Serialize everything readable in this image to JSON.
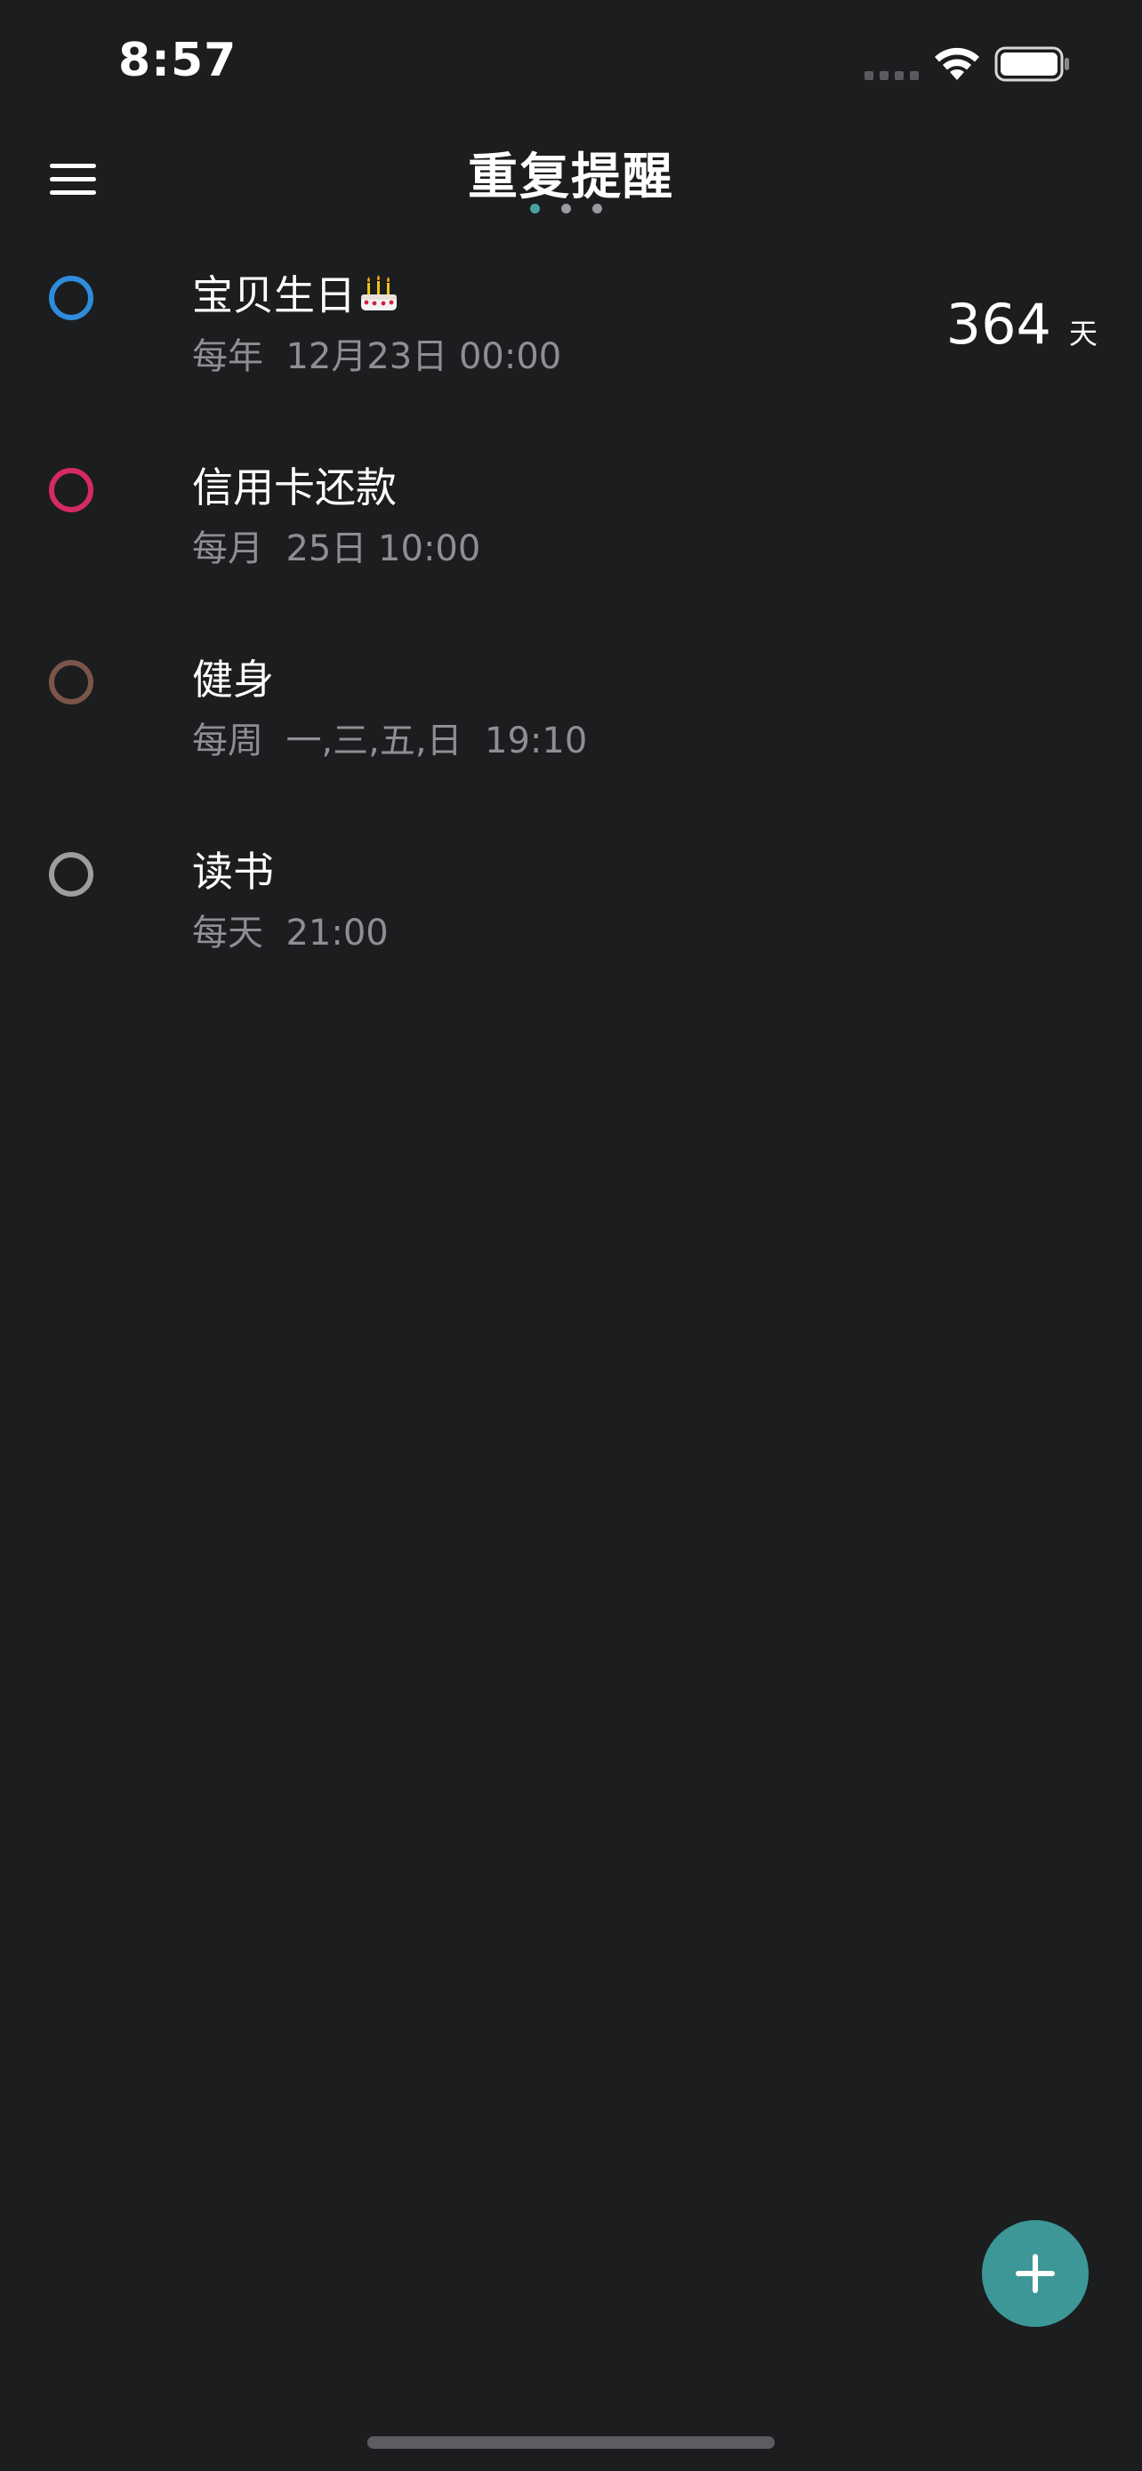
{
  "status_bar": {
    "time": "8:57",
    "wifi_icon": "wifi-icon",
    "battery_icon": "battery-icon"
  },
  "header": {
    "title": "重复提醒",
    "menu_icon": "hamburger-menu-icon",
    "page_indicator": {
      "total": 3,
      "active": 1
    }
  },
  "reminders": [
    {
      "title": "宝贝生日",
      "title_icon": "birthday-cake-icon",
      "frequency": "每年",
      "schedule": "12月23日 00:00",
      "circle_color": "#2e8cdc",
      "countdown": "364",
      "countdown_unit": "天"
    },
    {
      "title": "信用卡还款",
      "frequency": "每月",
      "schedule": "25日 10:00",
      "circle_color": "#d62a62"
    },
    {
      "title": "健身",
      "frequency": "每周",
      "schedule": "一,三,五,日  19:10",
      "circle_color": "#7b554a"
    },
    {
      "title": "读书",
      "frequency": "每天",
      "schedule": "21:00",
      "circle_color": "#9e9ea0"
    }
  ],
  "fab": {
    "icon": "plus-icon",
    "color": "#3d9797"
  }
}
